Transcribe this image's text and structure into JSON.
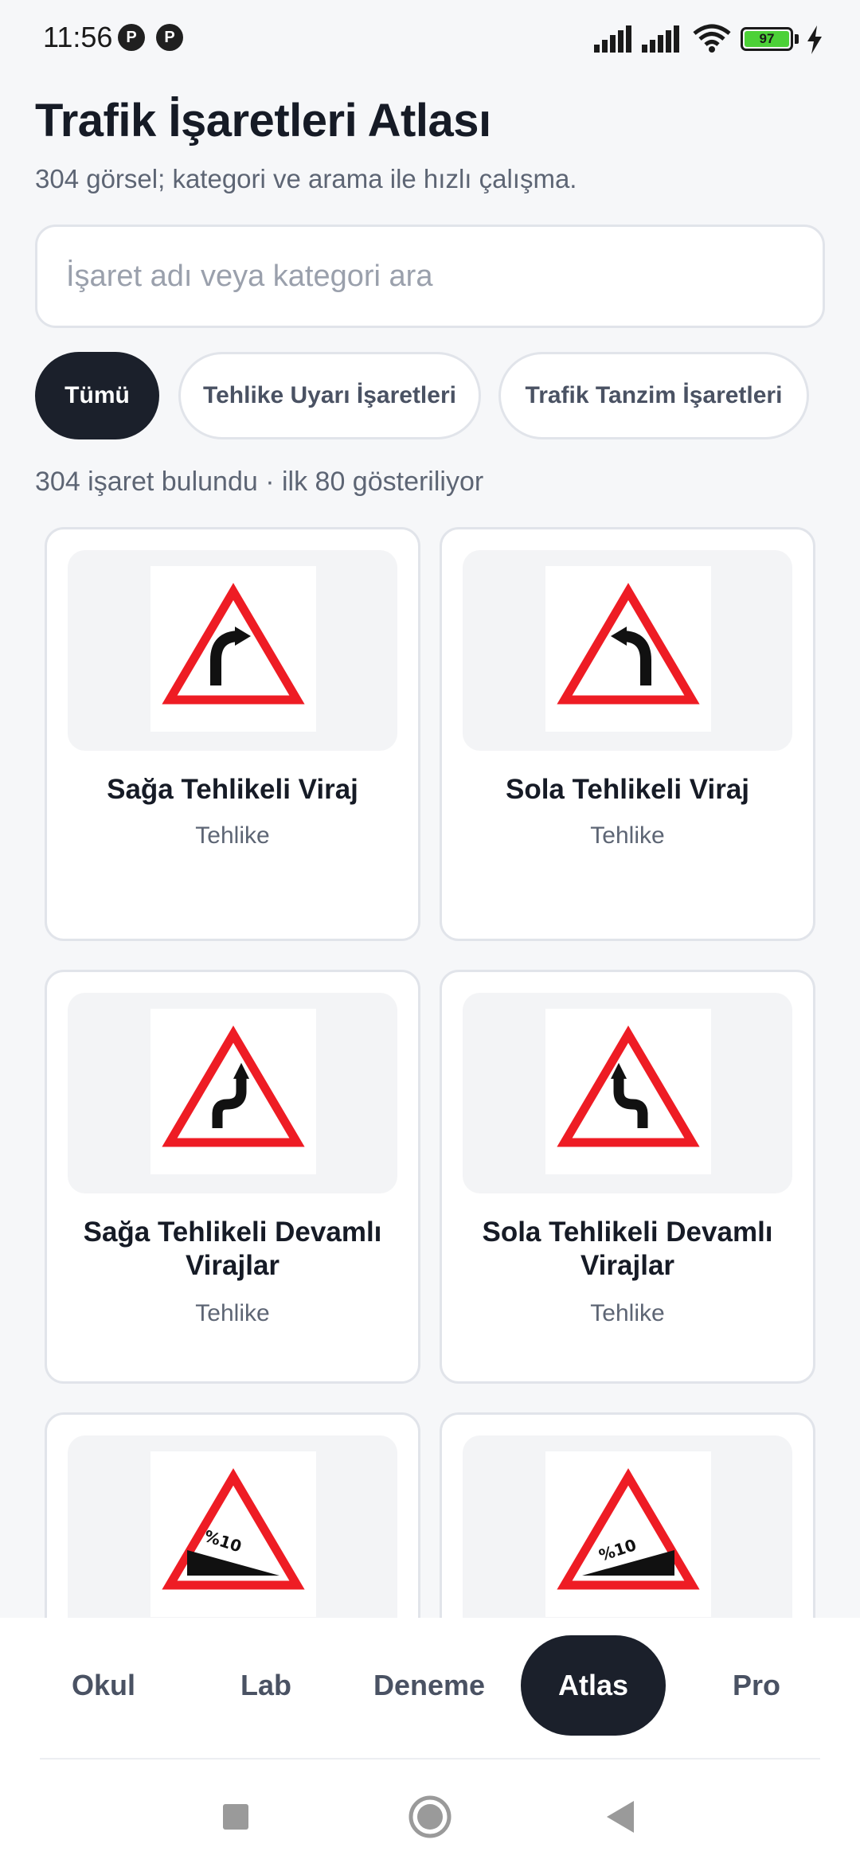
{
  "status_bar": {
    "time": "11:56",
    "app_icons": [
      "app-icon",
      "app-icon"
    ],
    "battery_level": "97",
    "charging": true
  },
  "header": {
    "title": "Trafik İşaretleri Atlası",
    "subtitle": "304 görsel; kategori ve arama ile hızlı çalışma."
  },
  "search": {
    "placeholder": "İşaret adı veya kategori ara",
    "value": ""
  },
  "filters": {
    "chips": [
      {
        "label": "Tümü",
        "active": true
      },
      {
        "label": "Tehlike Uyarı İşaretleri",
        "active": false
      },
      {
        "label": "Trafik Tanzim İşaretleri",
        "active": false
      }
    ]
  },
  "results": {
    "count_text": "304 işaret bulundu · ilk 80 gösteriliyor"
  },
  "cards": [
    {
      "title": "Sağa Tehlikeli Viraj",
      "category": "Tehlike",
      "icon": "right-curve-sign-icon"
    },
    {
      "title": "Sola Tehlikeli Viraj",
      "category": "Tehlike",
      "icon": "left-curve-sign-icon"
    },
    {
      "title": "Sağa Tehlikeli Devamlı Virajlar",
      "category": "Tehlike",
      "icon": "double-curve-right-sign-icon"
    },
    {
      "title": "Sola Tehlikeli Devamlı Virajlar",
      "category": "Tehlike",
      "icon": "double-curve-left-sign-icon"
    },
    {
      "title": "",
      "category": "",
      "icon": "steep-descent-sign-icon",
      "sign_text": "%10"
    },
    {
      "title": "",
      "category": "",
      "icon": "steep-ascent-sign-icon",
      "sign_text": "%10"
    }
  ],
  "bottom_nav": {
    "tabs": [
      {
        "label": "Okul",
        "active": false
      },
      {
        "label": "Lab",
        "active": false
      },
      {
        "label": "Deneme",
        "active": false
      },
      {
        "label": "Atlas",
        "active": true
      },
      {
        "label": "Pro",
        "active": false
      }
    ]
  },
  "system_nav": [
    "recents-icon",
    "home-icon",
    "back-icon"
  ],
  "colors": {
    "background": "#f6f7f9",
    "accent_dark": "#1b202b",
    "sign_red": "#ee1c24",
    "battery_green": "#4cd137"
  }
}
